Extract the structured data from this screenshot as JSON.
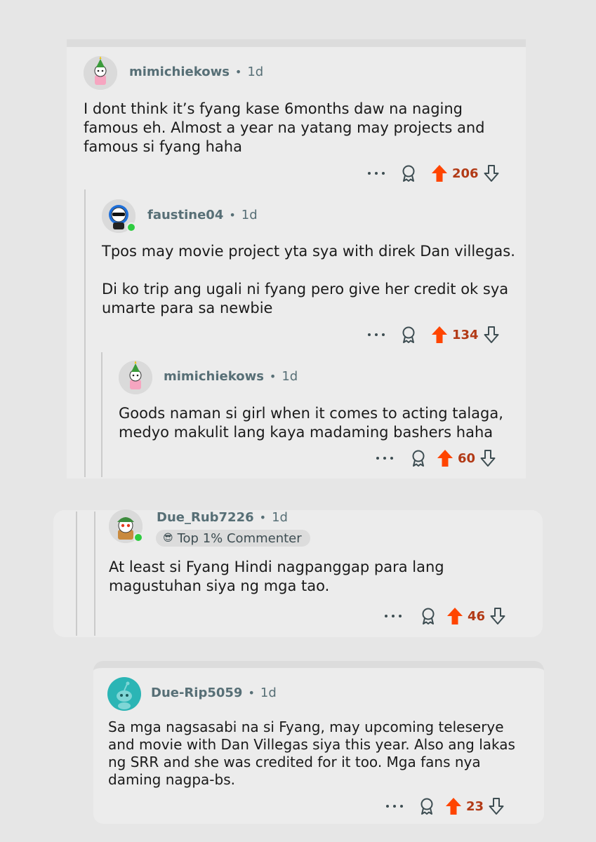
{
  "comments": [
    {
      "username": "mimichiekows",
      "sep": "•",
      "time": "1d",
      "body": [
        "I dont think it’s fyang kase 6months daw na naging famous eh. Almost a year na yatang may projects and famous si fyang haha"
      ],
      "votes": "206"
    },
    {
      "username": "faustine04",
      "sep": "•",
      "time": "1d",
      "body": [
        "Tpos may movie project yta sya with direk Dan villegas.",
        "Di ko trip ang ugali ni fyang pero give her credit ok sya umarte para sa newbie"
      ],
      "votes": "134"
    },
    {
      "username": "mimichiekows",
      "sep": "•",
      "time": "1d",
      "body": [
        "Goods naman si girl when it comes to acting talaga, medyo makulit lang kaya madaming bashers haha"
      ],
      "votes": "60"
    },
    {
      "username": "Due_Rub7226",
      "sep": "•",
      "time": "1d",
      "badge": "Top 1% Commenter",
      "body": [
        "At least si Fyang Hindi nagpanggap para lang magustuhan siya ng mga tao."
      ],
      "votes": "46"
    },
    {
      "username": "Due-Rip5059",
      "sep": "•",
      "time": "1d",
      "body": [
        "Sa mga nagsasabi na si Fyang, may upcoming teleserye and movie with Dan Villegas siya this year. Also ang lakas ng SRR and she was credited for it too. Mga fans nya daming nagpa-bs."
      ],
      "votes": "23"
    }
  ],
  "icons": {
    "more": "more-options-icon",
    "award": "award-icon",
    "upvote": "upvote-icon",
    "downvote": "downvote-icon"
  },
  "colors": {
    "upvote": "#ff4500",
    "vote_count": "#b23a16",
    "username": "#576f76",
    "online": "#2ecc40"
  }
}
